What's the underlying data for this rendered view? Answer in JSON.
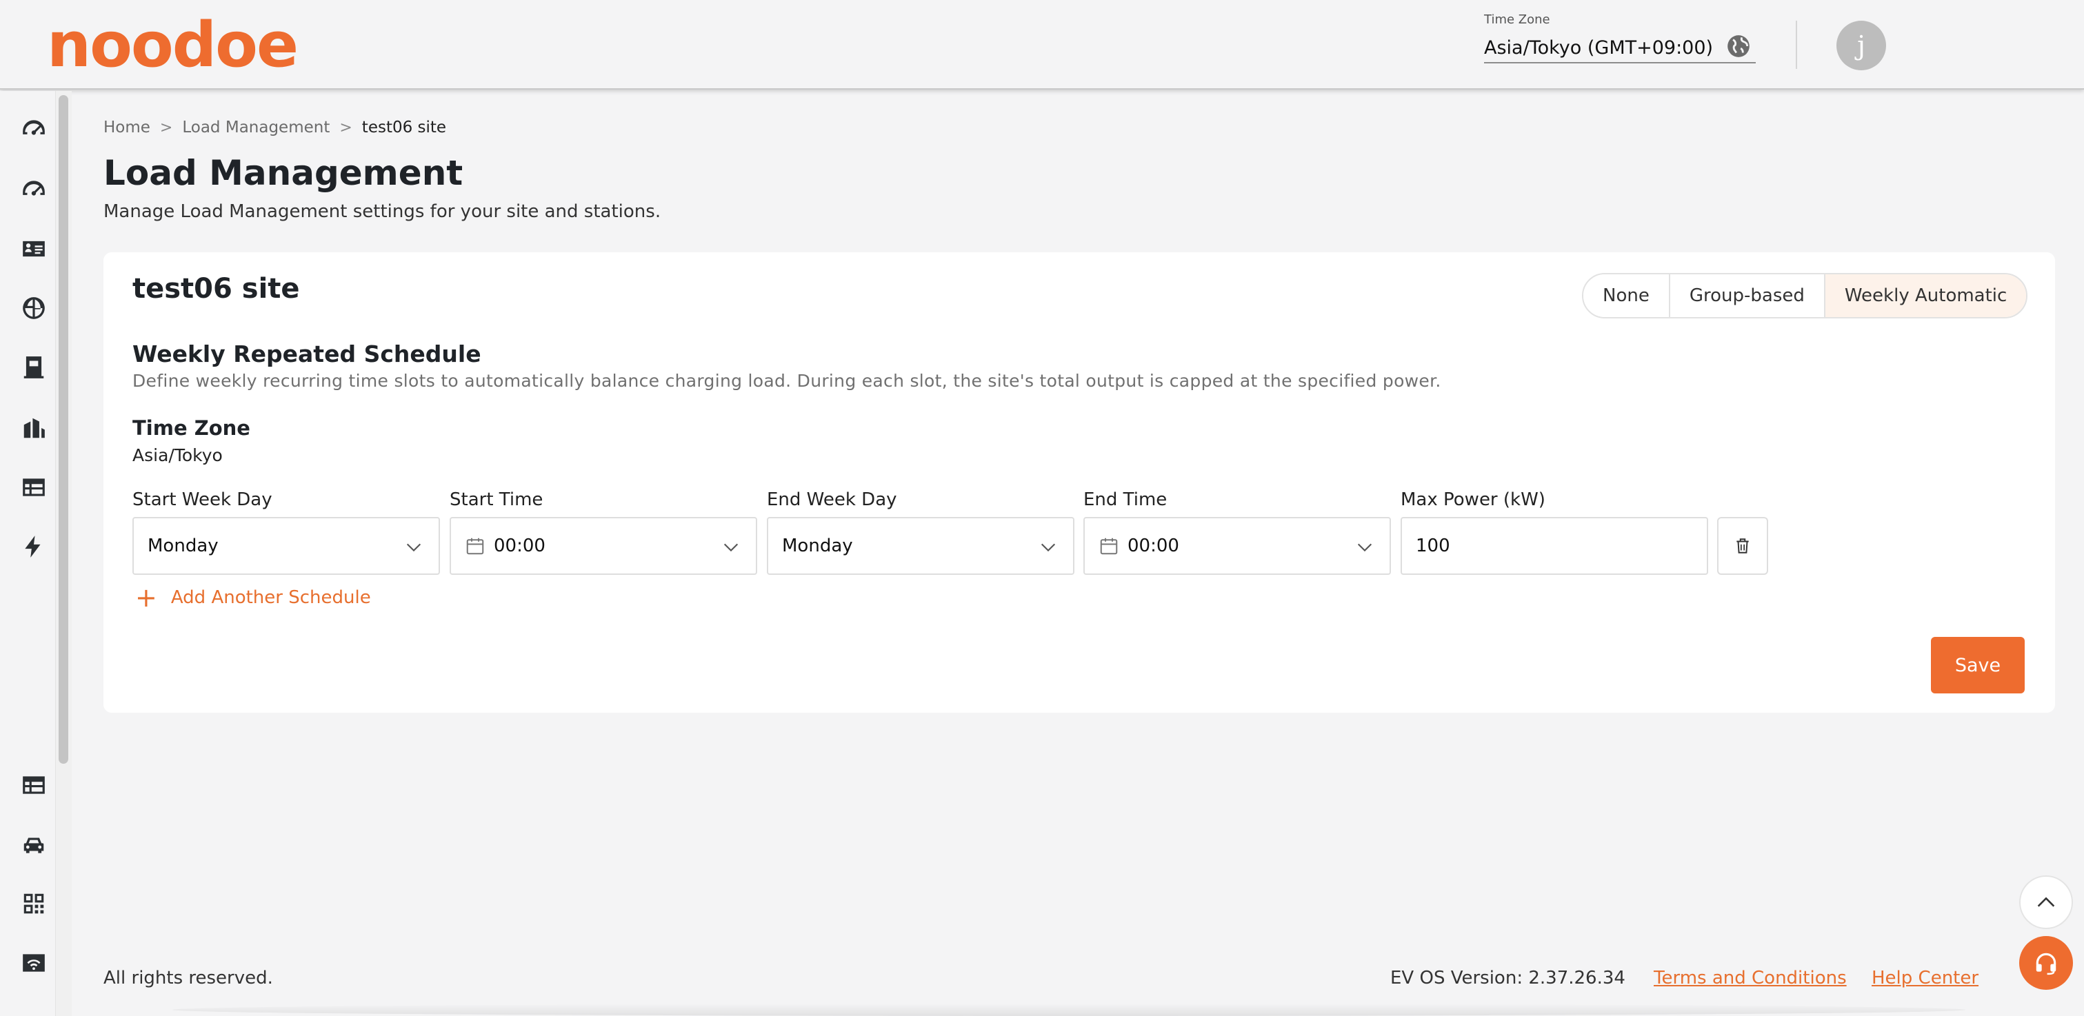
{
  "header": {
    "logo": "noodoe",
    "timezone_label": "Time Zone",
    "timezone_value": "Asia/Tokyo (GMT+09:00)",
    "avatar_initial": "j"
  },
  "sidebar": {
    "items": [
      {
        "icon": "dashboard-gauge-icon"
      },
      {
        "icon": "dashboard-gauge-icon"
      },
      {
        "icon": "id-card-icon"
      },
      {
        "icon": "globe-icon"
      },
      {
        "icon": "charger-icon"
      },
      {
        "icon": "buildings-icon"
      },
      {
        "icon": "table-icon"
      },
      {
        "icon": "lightning-icon"
      },
      {
        "icon": "table-icon"
      },
      {
        "icon": "car-icon"
      },
      {
        "icon": "qr-code-icon"
      },
      {
        "icon": "wifi-card-icon"
      }
    ]
  },
  "breadcrumb": {
    "items": [
      "Home",
      "Load Management",
      "test06 site"
    ],
    "separator": ">"
  },
  "page": {
    "title": "Load Management",
    "subtitle": "Manage Load Management settings for your site and stations."
  },
  "card": {
    "site_name": "test06 site",
    "modes": [
      "None",
      "Group-based",
      "Weekly Automatic"
    ],
    "active_mode": "Weekly Automatic",
    "section_title": "Weekly Repeated Schedule",
    "section_desc": "Define weekly recurring time slots to automatically balance charging load. During each slot, the site's total output is capped at the specified power.",
    "tz_title": "Time Zone",
    "tz_value": "Asia/Tokyo",
    "fields": {
      "start_week_day_label": "Start Week Day",
      "start_week_day_value": "Monday",
      "start_time_label": "Start Time",
      "start_time_value": "00:00",
      "end_week_day_label": "End Week Day",
      "end_week_day_value": "Monday",
      "end_time_label": "End Time",
      "end_time_value": "00:00",
      "max_power_label": "Max Power (kW)",
      "max_power_value": "100"
    },
    "add_label": "Add Another Schedule",
    "save_label": "Save"
  },
  "footer": {
    "rights": "All rights reserved.",
    "version": "EV OS Version: 2.37.26.34",
    "terms": "Terms and Conditions",
    "help": "Help Center"
  },
  "colors": {
    "accent": "#ee6c2f",
    "active_segment_bg": "#fdf2ea"
  }
}
